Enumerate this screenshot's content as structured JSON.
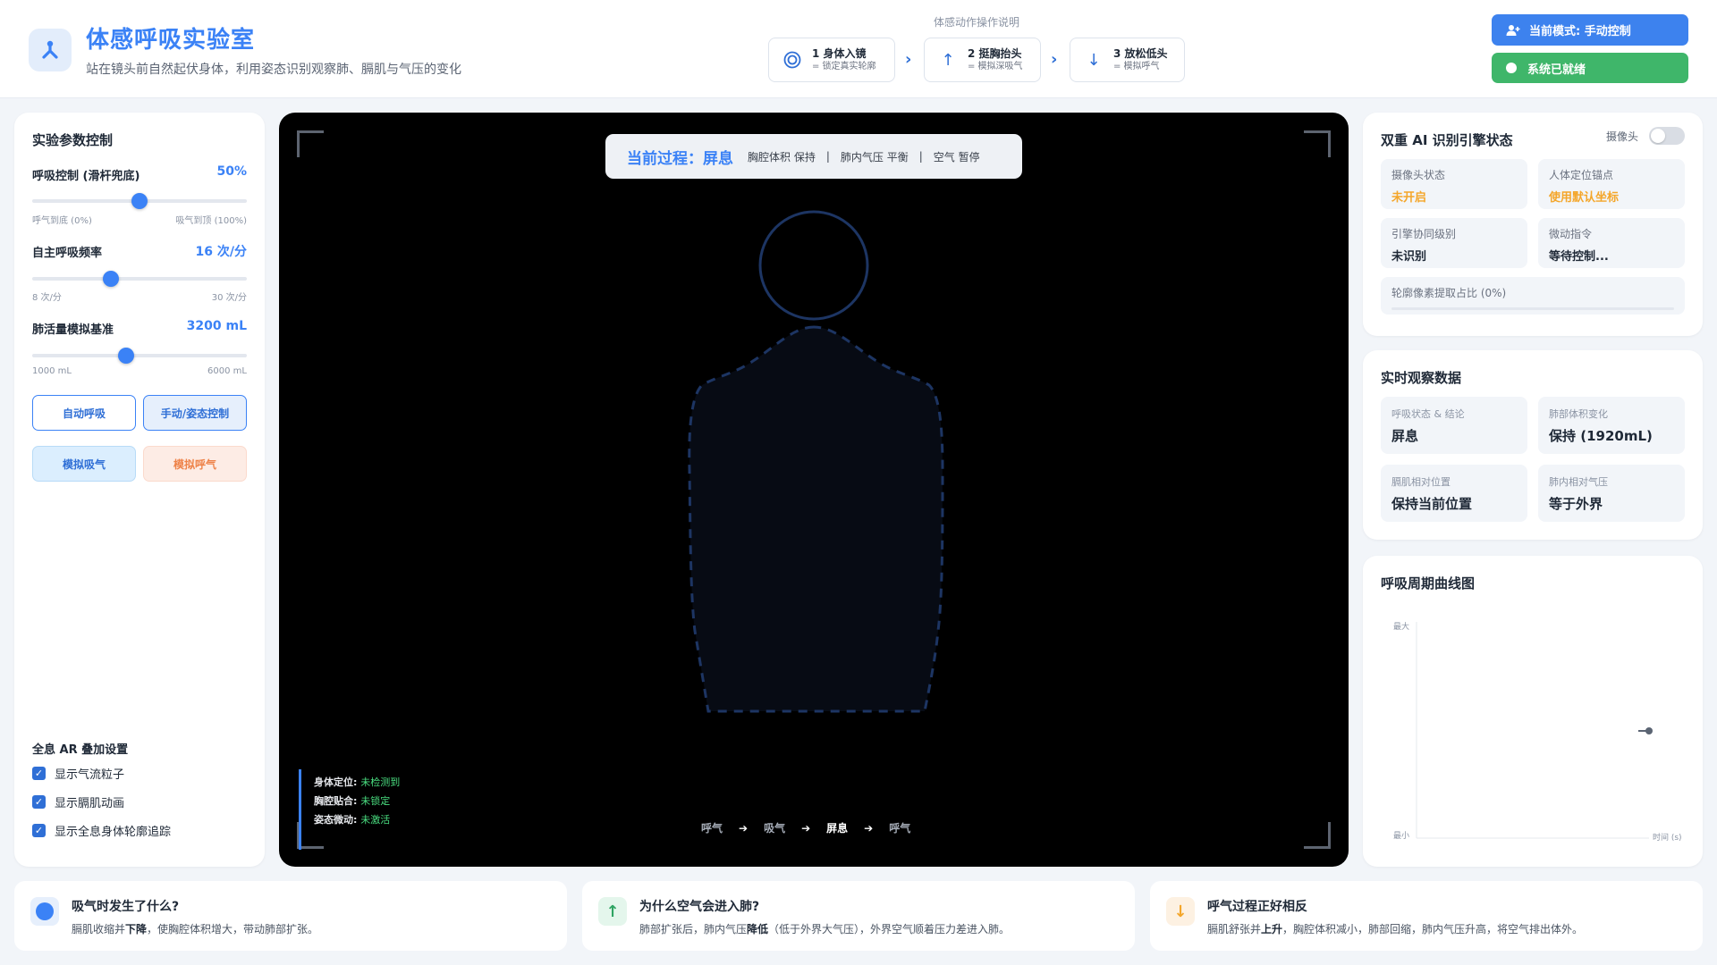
{
  "header": {
    "title": "体感呼吸实验室",
    "subtitle": "站在镜头前自然起伏身体，利用姿态识别观察肺、膈肌与气压的变化",
    "steps_caption": "体感动作操作说明",
    "steps": [
      {
        "num_label": "1 身体入镜",
        "desc": "= 锁定真实轮廓",
        "icon": "target-icon"
      },
      {
        "num_label": "2 挺胸抬头",
        "desc": "= 模拟深吸气",
        "icon": "arrow-up-icon"
      },
      {
        "num_label": "3 放松低头",
        "desc": "= 模拟呼气",
        "icon": "arrow-down-icon"
      }
    ],
    "mode_button": "当前模式: 手动控制",
    "ready_button": "系统已就绪"
  },
  "controls": {
    "title": "实验参数控制",
    "sliders": [
      {
        "label": "呼吸控制 (滑杆兜底)",
        "value": "50%",
        "min": "呼气到底 (0%)",
        "max": "吸气到顶 (100%)",
        "fraction": 0.5
      },
      {
        "label": "自主呼吸频率",
        "value": "16 次/分",
        "min": "8 次/分",
        "max": "30 次/分",
        "fraction": 0.36
      },
      {
        "label": "肺活量模拟基准",
        "value": "3200 mL",
        "min": "1000 mL",
        "max": "6000 mL",
        "fraction": 0.44
      }
    ],
    "auto_breath": "自动呼吸",
    "manual_control": "手动/姿态控制",
    "sim_inhale": "模拟吸气",
    "sim_exhale": "模拟呼气",
    "ar_title": "全息 AR 叠加设置",
    "ar_options": [
      "显示气流粒子",
      "显示膈肌动画",
      "显示全息身体轮廓追踪"
    ]
  },
  "camera": {
    "process_label": "当前过程：屏息",
    "process_items": [
      "胸腔体积 保持",
      "肺内气压 平衡",
      "空气 暂停"
    ],
    "status": [
      {
        "label": "身体定位:",
        "value": "未检测到"
      },
      {
        "label": "胸腔贴合:",
        "value": "未锁定"
      },
      {
        "label": "姿态微动:",
        "value": "未激活"
      }
    ],
    "sequence": [
      "呼气",
      "吸气",
      "屏息",
      "呼气"
    ],
    "current_index": 2
  },
  "ai": {
    "title": "双重 AI 识别引擎状态",
    "camera_label": "摄像头",
    "tiles": [
      {
        "k": "摄像头状态",
        "v": "未开启"
      },
      {
        "k": "人体定位锚点",
        "v": "使用默认坐标"
      },
      {
        "k": "引擎协同级别",
        "v": "未识别"
      },
      {
        "k": "微动指令",
        "v": "等待控制..."
      }
    ],
    "pixel_ratio": "轮廓像素提取占比 (0%)"
  },
  "observation": {
    "title": "实时观察数据",
    "tiles": [
      {
        "k": "呼吸状态 & 结论",
        "v": "屏息"
      },
      {
        "k": "肺部体积变化",
        "v": "保持 (1920mL)"
      },
      {
        "k": "膈肌相对位置",
        "v": "保持当前位置"
      },
      {
        "k": "肺内相对气压",
        "v": "等于外界"
      }
    ]
  },
  "curve": {
    "title": "呼吸周期曲线图",
    "y_max": "最大",
    "y_min": "最小",
    "x_label": "时间 (s)"
  },
  "info": [
    {
      "title": "吸气时发生了什么?",
      "pre": "膈肌收缩并",
      "b1": "下降",
      "mid": "，使胸腔体积增大，带动肺部扩张。",
      "b2": "",
      "post": ""
    },
    {
      "title": "为什么空气会进入肺?",
      "pre": "肺部扩张后，肺内气压",
      "b1": "降低",
      "mid": "（低于外界大气压），外界空气顺着压力差进入肺。",
      "b2": "",
      "post": ""
    },
    {
      "title": "呼气过程正好相反",
      "pre": "膈肌舒张并",
      "b1": "上升",
      "mid": "，胸腔体积减小，肺部回缩，肺内气压升高，将空气排出体外。",
      "b2": "",
      "post": ""
    }
  ],
  "colors": {
    "accent": "#3b82f6",
    "success": "#3fb66a",
    "warning": "#f4a62a",
    "exhale": "#ee8248"
  }
}
